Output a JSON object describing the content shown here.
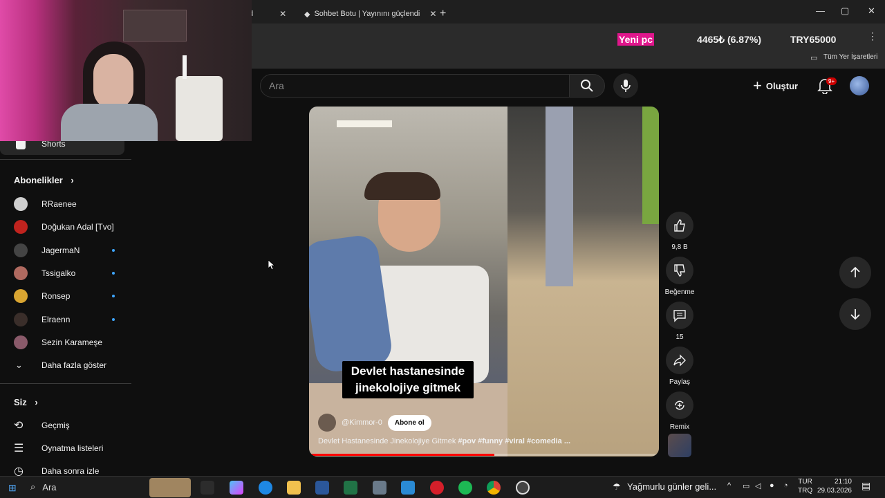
{
  "browser": {
    "tabs": [
      {
        "label": "d"
      },
      {
        "label": "Sohbet Botu | Yayınını güçlendi"
      }
    ],
    "bookmarks_label": "Tüm Yer İşaretleri"
  },
  "stock_overlay": {
    "tag": "Yeni pc",
    "value": "4465₺ (6.87%)",
    "goal": "TRY65000"
  },
  "youtube": {
    "search_placeholder": "Ara",
    "create_label": "Oluştur",
    "notification_badge": "9+"
  },
  "sidebar": {
    "shorts_label": "Shorts",
    "subscriptions_title": "Abonelikler",
    "subscriptions": [
      {
        "name": "RRaenee",
        "color": "#cfcfcf",
        "new": false
      },
      {
        "name": "Doğukan Adal [Tvo]",
        "color": "#c0231e",
        "new": false
      },
      {
        "name": "JagermaN",
        "color": "#444444",
        "new": true
      },
      {
        "name": "Tssigalko",
        "color": "#b06a60",
        "new": true
      },
      {
        "name": "Ronsep",
        "color": "#d9a531",
        "new": true
      },
      {
        "name": "Elraenn",
        "color": "#3a2e2a",
        "new": true
      },
      {
        "name": "Sezin Karameşe",
        "color": "#8a5a6a",
        "new": false
      }
    ],
    "show_more": "Daha fazla göster",
    "you_title": "Siz",
    "you_items": [
      {
        "label": "Geçmiş"
      },
      {
        "label": "Oynatma listeleri"
      },
      {
        "label": "Daha sonra izle"
      }
    ]
  },
  "short": {
    "caption_line1": "Devlet hastanesinde",
    "caption_line2": "jinekolojiye gitmek",
    "channel": "@Kimmor-0",
    "subscribe": "Abone ol",
    "title_plain": "Devlet Hastanesinde Jinekolojiye Gitmek",
    "title_tags": "#pov #funny #viral #comedia ...",
    "progress_fraction": 0.53
  },
  "actions": {
    "likes": "9,8 B",
    "dislike_label": "Beğenme",
    "comments": "15",
    "share_label": "Paylaş",
    "remix_label": "Remix"
  },
  "taskbar": {
    "search_placeholder": "Ara",
    "weather": "Yağmurlu günler geli...",
    "lang_top": "TUR",
    "lang_bottom": "TRQ",
    "time": "21:10",
    "date": "29.03.2026"
  }
}
